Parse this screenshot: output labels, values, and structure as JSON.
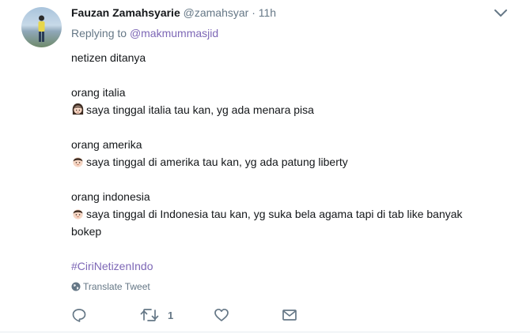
{
  "author": {
    "name": "Fauzan Zamahsyarie",
    "handle": "@zamahsyar",
    "separator": "·",
    "time": "11h"
  },
  "replying": {
    "prefix": "Replying to",
    "user": "@makmummasjid"
  },
  "body": {
    "intro": "netizen ditanya",
    "italia_label": "orang italia",
    "italia_text": "saya tinggal italia tau kan, yg ada menara pisa",
    "amerika_label": "orang amerika",
    "amerika_text": "saya tinggal di amerika tau kan, yg ada patung liberty",
    "indonesia_label": "orang indonesia",
    "indonesia_text_1": "saya tinggal di Indonesia tau kan, yg suka bela agama tapi di tab like banyak",
    "indonesia_text_2": "bokep",
    "hashtag": "#CiriNetizenIndo"
  },
  "translate": "Translate Tweet",
  "actions": {
    "retweet_count": "1"
  },
  "icons": {
    "emoji_italia": "girl-emoji",
    "emoji_amerika": "boy-emoji",
    "emoji_indonesia": "boy-emoji",
    "globe": "globe-icon",
    "reply": "reply-icon",
    "retweet": "retweet-icon",
    "like": "heart-icon",
    "dm": "envelope-icon",
    "caret": "chevron-down-icon"
  },
  "colors": {
    "accent": "#7d67b6",
    "muted": "#657786",
    "text": "#14171a"
  }
}
